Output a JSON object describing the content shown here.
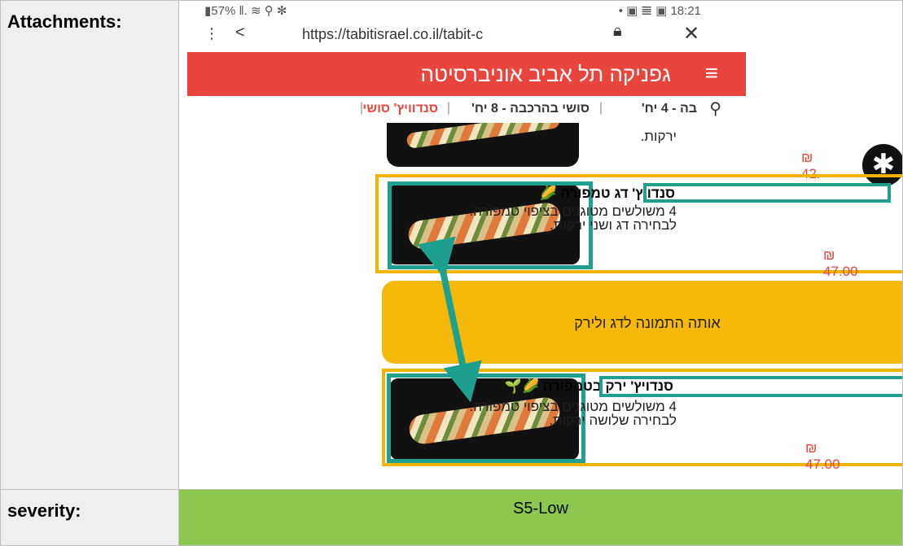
{
  "table": {
    "attachments_label": "Attachments:",
    "severity_label": "severity:",
    "severity_value": "S5-Low"
  },
  "screenshot": {
    "status_left": "▮57% ‖. ≋ ⚲ ✻",
    "status_right": "• ▣ 𝌆 ▣ 18:21",
    "url": "https://tabitisrael.co.il/tabit-c",
    "restaurant_title": "גפניקה תל אביב אוניברסיטה",
    "tabs": [
      "בה - 4 יח'",
      "סושי בהרכבה - 8 יח'",
      "סנדוויץ' סושי"
    ],
    "top_partial": {
      "desc": "ירקות.",
      "price": "₪ 42."
    },
    "items": [
      {
        "title": "סנדויץ' דג טמפורה 🌽",
        "desc": "4 משולשים מטוגנים בציפוי טמפורה. לבחירה דג ושני ירקות.",
        "price": "₪ 47.00"
      },
      {
        "title": "סנדויץ' ירק בטמפורה 🌽🌱",
        "desc": "4 משולשים מטוגנים בציפוי טמפורה. לבחירה שלושה ירקות.",
        "price": "₪ 47.00"
      }
    ],
    "annotation_note": "אותה התמונה לדג ולירק"
  },
  "colors": {
    "header_red": "#e8453c",
    "note_yellow": "#f6b90a",
    "highlight_teal": "#1f9f8e",
    "severity_green": "#8cc850"
  },
  "icons": [
    "menu-dots-icon",
    "share-icon",
    "lock-icon",
    "close-icon",
    "hamburger-icon",
    "search-icon",
    "accessibility-icon"
  ]
}
